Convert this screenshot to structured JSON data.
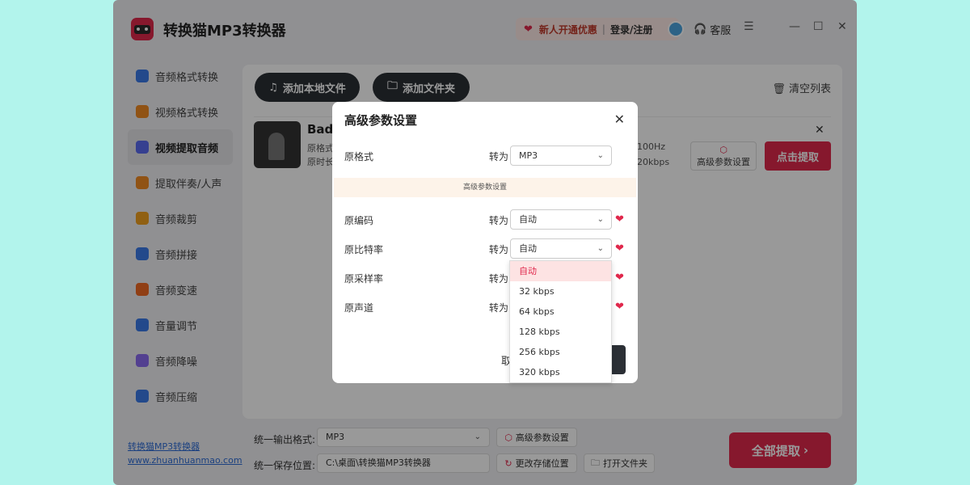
{
  "app": {
    "title": "转换猫MP3转换器",
    "promo_text": "新人开通优惠",
    "separator": "|",
    "login": "登录/注册",
    "service": "客服"
  },
  "sidebar": {
    "items": [
      {
        "label": "音频格式转换",
        "color": "#3b7be8"
      },
      {
        "label": "视频格式转换",
        "color": "#f08a24"
      },
      {
        "label": "视频提取音频",
        "color": "#5b6cf0"
      },
      {
        "label": "提取伴奏/人声",
        "color": "#f08a24"
      },
      {
        "label": "音频裁剪",
        "color": "#f0a020"
      },
      {
        "label": "音频拼接",
        "color": "#3b7be8"
      },
      {
        "label": "音频变速",
        "color": "#f06a24"
      },
      {
        "label": "音量调节",
        "color": "#3b7be8"
      },
      {
        "label": "音频降噪",
        "color": "#8a6cf0"
      },
      {
        "label": "音频压缩",
        "color": "#3b7be8"
      }
    ],
    "active_index": 2,
    "site_name": "转换猫MP3转换器",
    "site_url": "www.zhuanhuanmao.com"
  },
  "toolbar": {
    "add_file": "添加本地文件",
    "add_folder": "添加文件夹",
    "clear_list": "清空列表"
  },
  "file": {
    "name": "Bad",
    "meta1": "原格式",
    "meta2": "原时长",
    "meta_right1": "100Hz",
    "meta_right2": "20kbps",
    "adv_btn": "高级参数设置",
    "extract_btn": "点击提取"
  },
  "bottom": {
    "format_label": "统一输出格式:",
    "format_value": "MP3",
    "adv_btn": "高级参数设置",
    "save_label": "统一保存位置:",
    "save_path": "C:\\桌面\\转换猫MP3转换器",
    "change_btn": "更改存储位置",
    "open_btn": "打开文件夹",
    "all_extract": "全部提取"
  },
  "modal": {
    "title": "高级参数设置",
    "to_label": "转为",
    "format_label": "原格式",
    "format_value": "MP3",
    "section_title": "高级参数设置",
    "codec_label": "原编码",
    "codec_value": "自动",
    "bitrate_label": "原比特率",
    "bitrate_value": "自动",
    "samplerate_label": "原采样率",
    "channel_label": "原声道",
    "cancel": "取"
  },
  "dropdown": {
    "options": [
      "自动",
      "32 kbps",
      "64 kbps",
      "128 kbps",
      "256 kbps",
      "320 kbps"
    ],
    "selected_index": 0
  },
  "colors": {
    "accent": "#e0284c",
    "dark_button": "#2b2f35",
    "background": "#b2f4ec"
  }
}
